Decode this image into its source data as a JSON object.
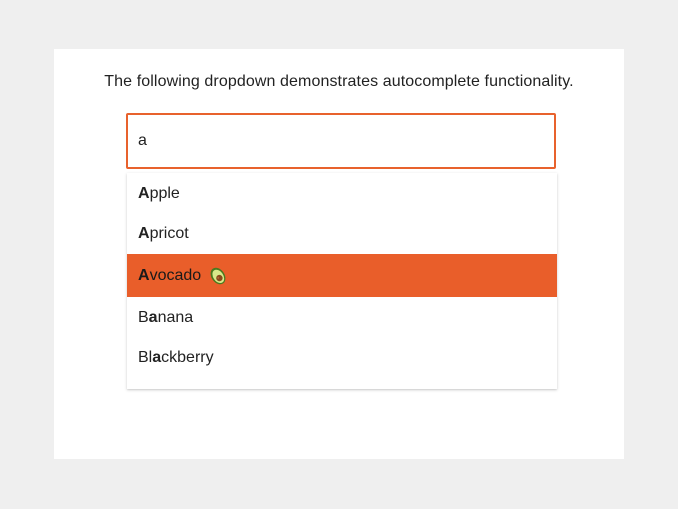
{
  "description": "The following dropdown demonstrates autocomplete functionality.",
  "input": {
    "value": "a"
  },
  "options": [
    {
      "prefix": "",
      "match": "A",
      "rest": "pple",
      "active": false
    },
    {
      "prefix": "",
      "match": "A",
      "rest": "pricot",
      "active": false
    },
    {
      "prefix": "",
      "match": "A",
      "rest": "vocado",
      "active": true,
      "icon": "avocado-icon"
    },
    {
      "prefix": "B",
      "match": "a",
      "rest": "nana",
      "active": false
    },
    {
      "prefix": "Bl",
      "match": "a",
      "rest": "ckberry",
      "active": false
    }
  ],
  "colors": {
    "page_bg": "#efefef",
    "card_bg": "#ffffff",
    "accent": "#e8622d",
    "active_bg": "#e95e2a"
  }
}
